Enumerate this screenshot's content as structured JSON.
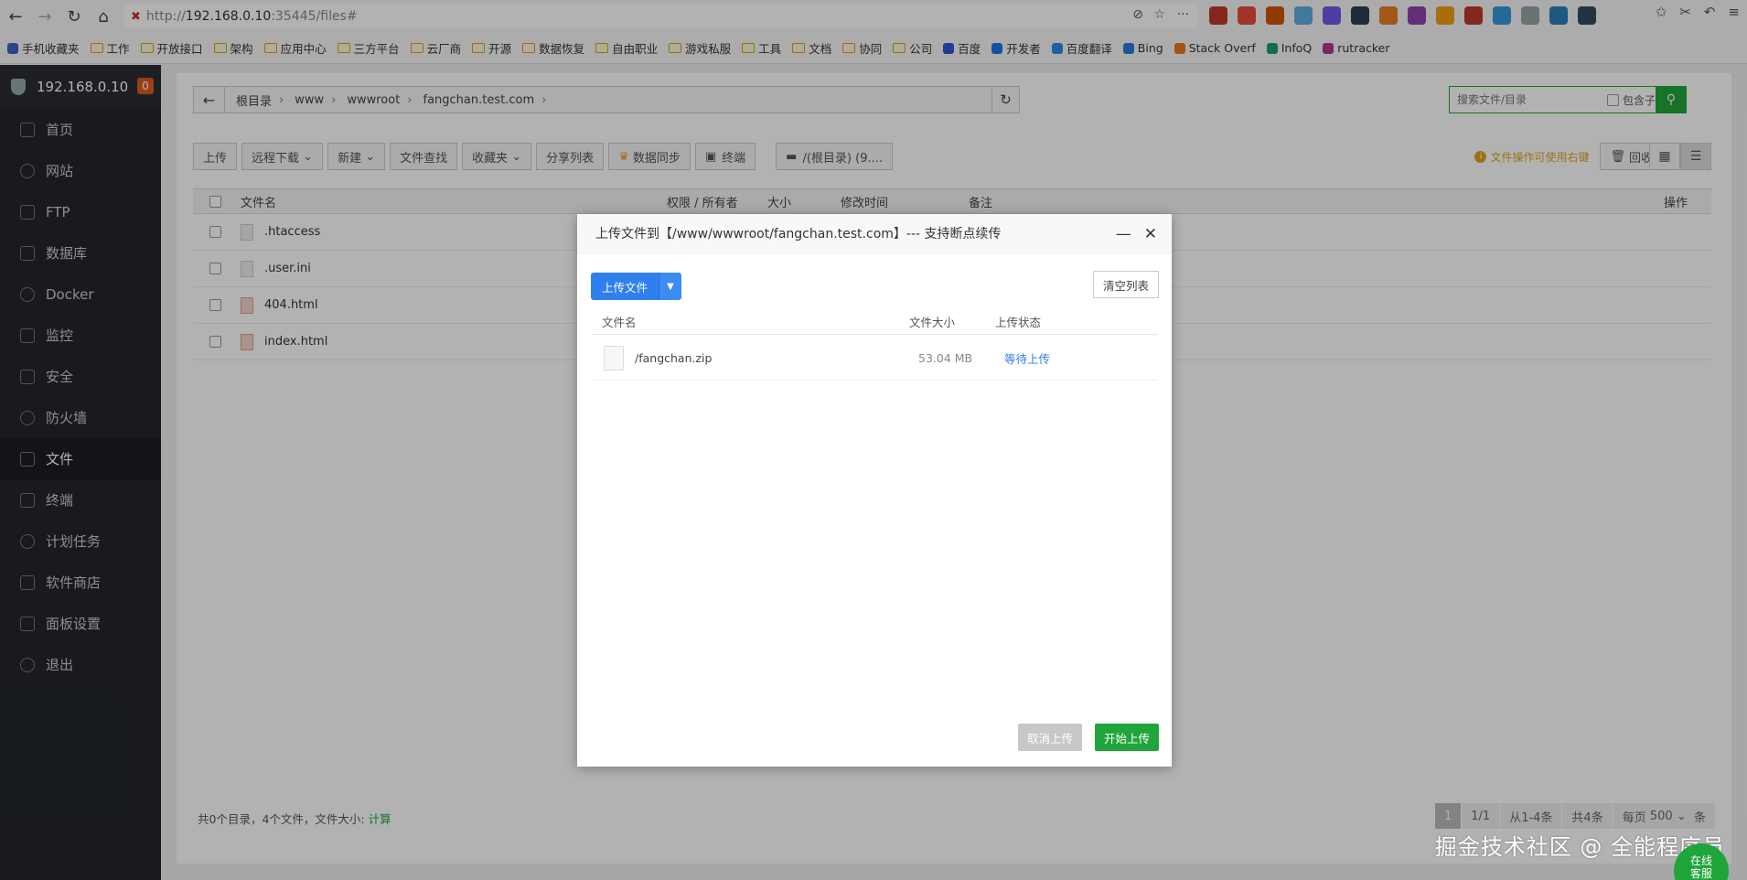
{
  "browser": {
    "url_scheme": "http://",
    "url_host": "192.168.0.10",
    "url_rest": ":35445/files#",
    "bookmarks": [
      {
        "label": "手机收藏夹",
        "color": "#3a64c8"
      },
      {
        "label": "工作",
        "color": "folder"
      },
      {
        "label": "开放接口",
        "color": "folder"
      },
      {
        "label": "架构",
        "color": "folder"
      },
      {
        "label": "应用中心",
        "color": "folder"
      },
      {
        "label": "三方平台",
        "color": "folder"
      },
      {
        "label": "云厂商",
        "color": "folder"
      },
      {
        "label": "开源",
        "color": "folder"
      },
      {
        "label": "数据恢复",
        "color": "folder"
      },
      {
        "label": "自由职业",
        "color": "folder"
      },
      {
        "label": "游戏私服",
        "color": "folder"
      },
      {
        "label": "工具",
        "color": "folder"
      },
      {
        "label": "文档",
        "color": "folder"
      },
      {
        "label": "协同",
        "color": "folder"
      },
      {
        "label": "公司",
        "color": "folder"
      },
      {
        "label": "百度",
        "color": "#2b58d9"
      },
      {
        "label": "开发者",
        "color": "#1e73e8"
      },
      {
        "label": "百度翻译",
        "color": "#2b8ae8"
      },
      {
        "label": "Bing",
        "color": "#2a7bd6"
      },
      {
        "label": "Stack Overf",
        "color": "#e87922"
      },
      {
        "label": "InfoQ",
        "color": "#1d9c6a"
      },
      {
        "label": "rutracker",
        "color": "#b43a8c"
      }
    ],
    "ext_colors": [
      "#c0392b",
      "#e74c3c",
      "#d35400",
      "#5dade2",
      "#6c5ce7",
      "#2c3e50",
      "#e67e22",
      "#8e44ad",
      "#f39c12",
      "#c0392b",
      "#3498db",
      "#95a5a6",
      "#2980b9",
      "#34495e"
    ]
  },
  "sidebar": {
    "host": "192.168.0.10",
    "badge": "0",
    "items": [
      {
        "label": "首页",
        "icon": "home-icon"
      },
      {
        "label": "网站",
        "icon": "globe-icon"
      },
      {
        "label": "FTP",
        "icon": "ftp-icon"
      },
      {
        "label": "数据库",
        "icon": "database-icon"
      },
      {
        "label": "Docker",
        "icon": "docker-icon"
      },
      {
        "label": "监控",
        "icon": "monitor-icon"
      },
      {
        "label": "安全",
        "icon": "shield-icon"
      },
      {
        "label": "防火墙",
        "icon": "firewall-icon"
      },
      {
        "label": "文件",
        "icon": "folder-icon",
        "active": true
      },
      {
        "label": "终端",
        "icon": "terminal-icon"
      },
      {
        "label": "计划任务",
        "icon": "calendar-icon"
      },
      {
        "label": "软件商店",
        "icon": "store-icon"
      },
      {
        "label": "面板设置",
        "icon": "gear-icon"
      },
      {
        "label": "退出",
        "icon": "logout-icon"
      }
    ]
  },
  "breadcrumb": [
    "根目录",
    "www",
    "wwwroot",
    "fangchan.test.com"
  ],
  "search": {
    "placeholder": "搜索文件/目录",
    "subdir_label": "包含子目录"
  },
  "toolbar": {
    "upload": "上传",
    "remote_download": "远程下载",
    "new": "新建",
    "find": "文件查找",
    "favorites": "收藏夹",
    "share_list": "分享列表",
    "sync": "数据同步",
    "terminal": "终端",
    "disk": "/(根目录) (9....",
    "tip": "文件操作可使用右键",
    "recycle": "回收站"
  },
  "table": {
    "headers": {
      "name": "文件名",
      "perm": "权限 / 所有者",
      "size": "大小",
      "mtime": "修改时间",
      "note": "备注",
      "ops": "操作"
    },
    "rows": [
      {
        "name": ".htaccess",
        "type": "file"
      },
      {
        "name": ".user.ini",
        "type": "file"
      },
      {
        "name": "404.html",
        "type": "html"
      },
      {
        "name": "index.html",
        "type": "html"
      }
    ]
  },
  "footer": {
    "summary": "共0个目录，4个文件，文件大小:",
    "calc_link": "计算"
  },
  "pager": {
    "current": "1",
    "pages": "1/1",
    "range": "从1-4条",
    "total": "共4条",
    "per_page_label": "每页",
    "per_page_value": "500",
    "unit": "条"
  },
  "dialog": {
    "title": "上传文件到【/www/wwwroot/fangchan.test.com】--- 支持断点续传",
    "upload_button": "上传文件",
    "clear_button": "清空列表",
    "headers": {
      "name": "文件名",
      "size": "文件大小",
      "status": "上传状态"
    },
    "files": [
      {
        "name": "/fangchan.zip",
        "size": "53.04 MB",
        "status": "等待上传"
      }
    ],
    "cancel_button": "取消上传",
    "start_button": "开始上传"
  },
  "watermark": "掘金技术社区 @ 全能程序员",
  "online_service": {
    "line1": "在线",
    "line2": "客服"
  }
}
